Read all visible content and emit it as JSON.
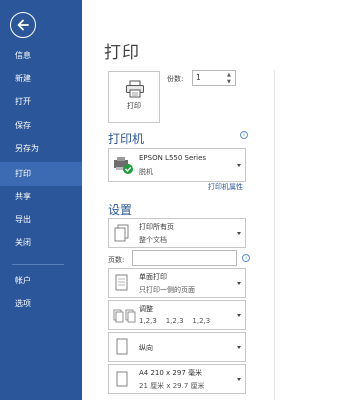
{
  "sidebar": {
    "back_label": "",
    "items": [
      {
        "label": "信息"
      },
      {
        "label": "新建"
      },
      {
        "label": "打开"
      },
      {
        "label": "保存"
      },
      {
        "label": "另存为"
      },
      {
        "label": "打印"
      },
      {
        "label": "共享"
      },
      {
        "label": "导出"
      },
      {
        "label": "关闭"
      },
      {
        "label": "帐户"
      },
      {
        "label": "选项"
      }
    ],
    "active_index": 5,
    "color": "#2b579a"
  },
  "main": {
    "title": "打印",
    "print_button_label": "打印",
    "copies_label": "份数:",
    "copies_value": "1",
    "printer_section": "打印机",
    "printer_name": "EPSON L550 Series",
    "printer_status": "脱机",
    "printer_properties_link": "打印机属性",
    "settings_section": "设置",
    "print_range_line1": "打印所有页",
    "print_range_line2": "整个文档",
    "pages_label": "页数:",
    "pages_value": "",
    "sides_line1": "单面打印",
    "sides_line2": "只打印一侧的页面",
    "collate_line1": "调整",
    "collate_line2": "1,2,3    1,2,3    1,2,3",
    "orientation_line1": "纵向",
    "paper_line1": "A4 210 x 297 毫米",
    "paper_line2": "21 厘米 x 29.7 厘米",
    "accent_color": "#2b579a"
  }
}
